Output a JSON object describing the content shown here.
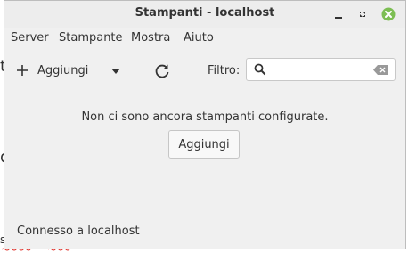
{
  "background": {
    "fragments": [
      "t",
      "d",
      "s"
    ]
  },
  "window": {
    "title": "Stampanti - localhost",
    "minimize_icon": "minimize-icon",
    "maximize_icon": "maximize-icon",
    "close_icon": "close-icon",
    "close_color": "#7cbe52"
  },
  "menubar": {
    "items": [
      "Server",
      "Stampante",
      "Mostra",
      "Aiuto"
    ]
  },
  "toolbar": {
    "add_label": "Aggiungi",
    "add_icon": "plus-icon",
    "dropdown_icon": "caret-down-icon",
    "refresh_icon": "refresh-icon",
    "filter_label": "Filtro:",
    "search": {
      "value": "",
      "placeholder": "",
      "icon": "search-icon",
      "clear_icon": "clear-icon"
    }
  },
  "content": {
    "empty_message": "Non ci sono ancora stampanti configurate.",
    "add_button_label": "Aggiungi"
  },
  "statusbar": {
    "text": "Connesso a localhost"
  }
}
